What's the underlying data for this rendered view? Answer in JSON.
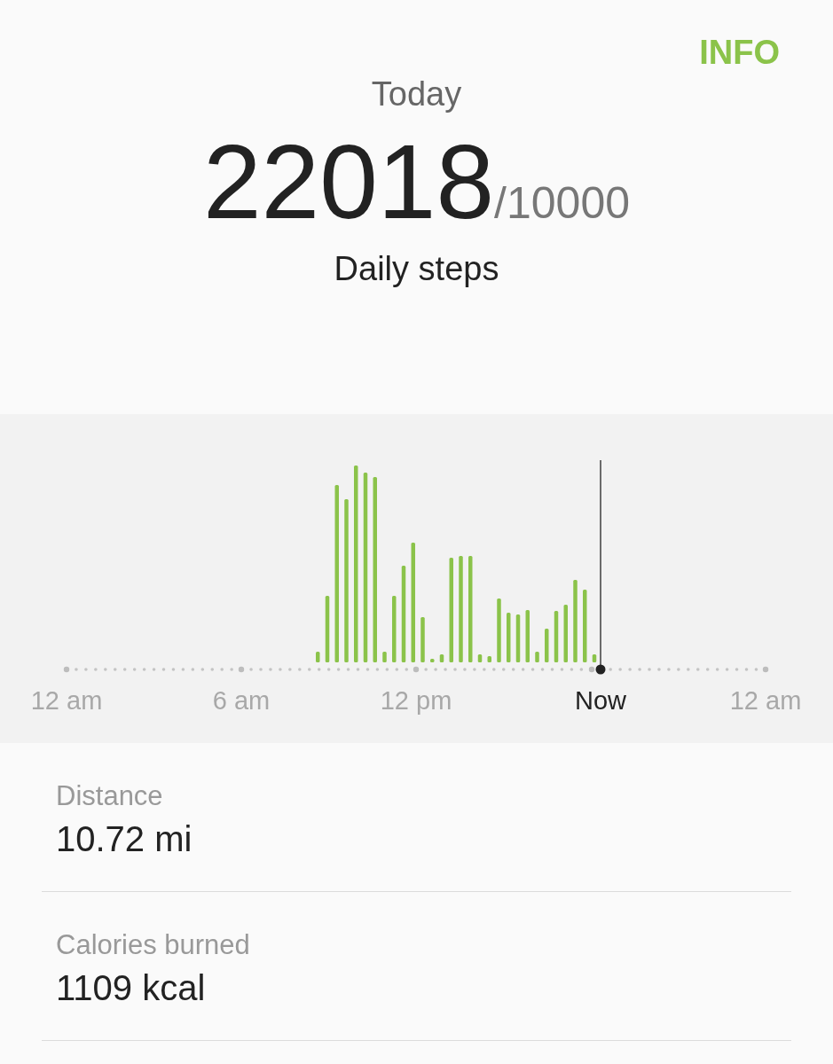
{
  "header": {
    "action": "INFO"
  },
  "summary": {
    "period": "Today",
    "steps": "22018",
    "goal": "/10000",
    "label": "Daily steps"
  },
  "chart": {
    "x_labels": [
      {
        "text": "12 am",
        "selected": false
      },
      {
        "text": "6 am",
        "selected": false
      },
      {
        "text": "12 pm",
        "selected": false
      },
      {
        "text": "Now",
        "selected": true
      },
      {
        "text": "12 am",
        "selected": false
      }
    ]
  },
  "stats": [
    {
      "label": "Distance",
      "value": "10.72 mi"
    },
    {
      "label": "Calories burned",
      "value": "1109 kcal"
    }
  ]
}
